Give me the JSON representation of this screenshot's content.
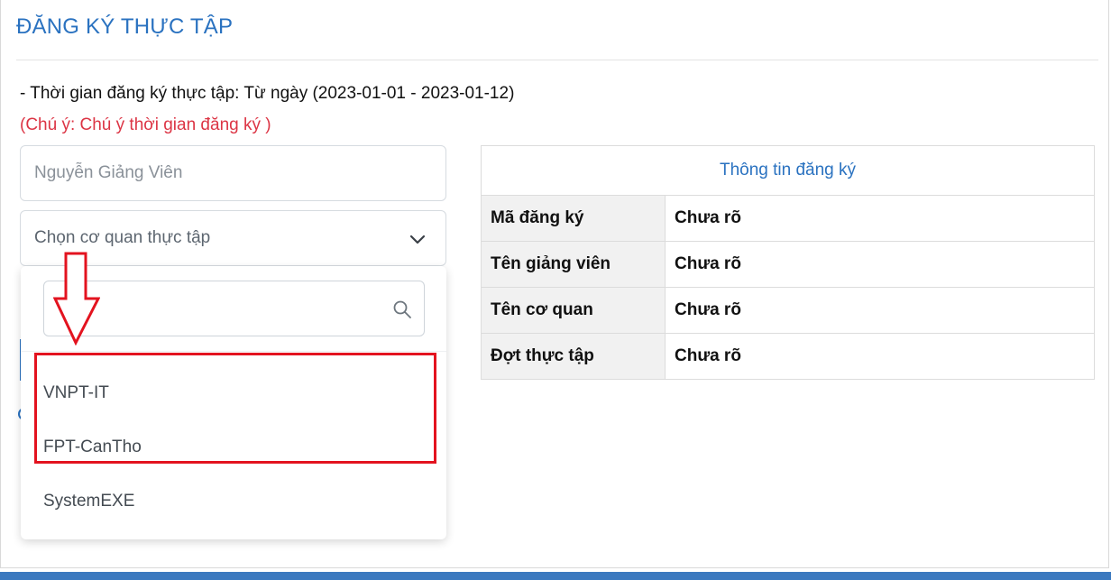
{
  "page": {
    "title": "ĐĂNG KÝ THỰC TẬP"
  },
  "registration": {
    "period_text": "- Thời gian đăng ký thực tập: Từ ngày (2023-01-01 - 2023-01-12)",
    "note_text": "(Chú ý: Chú ý thời gian đăng ký )"
  },
  "form": {
    "lecturer_placeholder": "Nguyễn Giảng Viên",
    "agency_select_label": "Chọn cơ quan thực tập"
  },
  "dropdown": {
    "search_value": "",
    "options": [
      "VNPT-IT",
      "FPT-CanTho",
      "SystemEXE"
    ]
  },
  "info_table": {
    "header": "Thông tin đăng ký",
    "rows": [
      {
        "label": "Mã đăng ký",
        "value": "Chưa rõ"
      },
      {
        "label": "Tên giảng viên",
        "value": "Chưa rõ"
      },
      {
        "label": "Tên cơ quan",
        "value": "Chưa rõ"
      },
      {
        "label": "Đợt thực tập",
        "value": "Chưa rõ"
      }
    ]
  },
  "colors": {
    "accent": "#2a72c0",
    "warning": "#dc3545",
    "annotation": "#e3131f"
  },
  "icons": {
    "select_toggle": "chevron-down-icon",
    "search": "search-icon",
    "annotation_arrow": "down-arrow-icon"
  }
}
